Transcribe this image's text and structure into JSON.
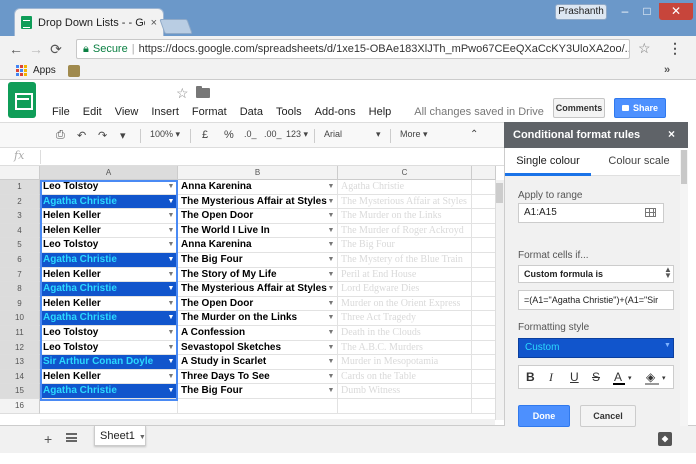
{
  "browser": {
    "tab_title": "Drop Down Lists - - Goo",
    "tab_close": "×",
    "user_name": "Prashanth",
    "win_min": "–",
    "win_max": "□",
    "win_close": "✕",
    "secure_label": "Secure",
    "url": "https://docs.google.com/spreadsheets/d/1xe15-OBAe183XlJTh_mPwo67CEeQXaCcKY3UloXA2oo/...",
    "bookmarks": {
      "apps_label": "Apps"
    },
    "more_label": "»"
  },
  "sheets": {
    "menu": [
      "File",
      "Edit",
      "View",
      "Insert",
      "Format",
      "Data",
      "Tools",
      "Add-ons",
      "Help"
    ],
    "save_status": "All changes saved in Drive",
    "comments_label": "Comments",
    "share_label": "Share",
    "toolbar": {
      "zoom": "100%",
      "currency": "£",
      "percent": "%",
      "dec_less": ".0_",
      "dec_more": ".00_",
      "format_more": "123",
      "font": "Arial",
      "more": "More"
    },
    "fx_label": "fx",
    "columns": [
      "A",
      "B",
      "C"
    ],
    "rows": [
      {
        "num": "1",
        "a": "Leo Tolstoy",
        "b": "Anna Karenina",
        "c": "Agatha Christie",
        "hl": false
      },
      {
        "num": "2",
        "a": "Agatha Christie",
        "b": "The Mysterious Affair at Styles",
        "c": "The Mysterious Affair at Styles",
        "hl": true
      },
      {
        "num": "3",
        "a": "Helen Keller",
        "b": "The Open Door",
        "c": "The Murder on the Links",
        "hl": false
      },
      {
        "num": "4",
        "a": "Helen Keller",
        "b": "The World I Live In",
        "c": "The Murder of Roger Ackroyd",
        "hl": false
      },
      {
        "num": "5",
        "a": "Leo Tolstoy",
        "b": "Anna Karenina",
        "c": "The Big Four",
        "hl": false
      },
      {
        "num": "6",
        "a": "Agatha Christie",
        "b": "The Big Four",
        "c": "The Mystery of the Blue Train",
        "hl": true
      },
      {
        "num": "7",
        "a": "Helen Keller",
        "b": "The Story of My Life",
        "c": "Peril at End House",
        "hl": false
      },
      {
        "num": "8",
        "a": "Agatha Christie",
        "b": "The Mysterious Affair at Styles",
        "c": "Lord Edgware Dies",
        "hl": true
      },
      {
        "num": "9",
        "a": "Helen Keller",
        "b": "The Open Door",
        "c": "Murder on the Orient Express",
        "hl": false
      },
      {
        "num": "10",
        "a": "Agatha Christie",
        "b": "The Murder on the Links",
        "c": "Three Act Tragedy",
        "hl": true
      },
      {
        "num": "11",
        "a": "Leo Tolstoy",
        "b": "A Confession",
        "c": "Death in the Clouds",
        "hl": false
      },
      {
        "num": "12",
        "a": "Leo Tolstoy",
        "b": "Sevastopol Sketches",
        "c": "The A.B.C. Murders",
        "hl": false
      },
      {
        "num": "13",
        "a": "Sir Arthur Conan Doyle",
        "b": "A Study in Scarlet",
        "c": "Murder in Mesopotamia",
        "hl": true
      },
      {
        "num": "14",
        "a": "Helen Keller",
        "b": "Three Days To See",
        "c": "Cards on the Table",
        "hl": false
      },
      {
        "num": "15",
        "a": "Agatha Christie",
        "b": "The Big Four",
        "c": "Dumb Witness",
        "hl": true
      },
      {
        "num": "16",
        "a": "",
        "b": "",
        "c": "",
        "hl": false
      }
    ],
    "sheet_tab": "Sheet1"
  },
  "panel": {
    "title": "Conditional format rules",
    "close": "×",
    "tab_single": "Single colour",
    "tab_scale": "Colour scale",
    "apply_label": "Apply to range",
    "range_value": "A1:A15",
    "format_cells_label": "Format cells if...",
    "condition": "Custom formula is",
    "formula": "=(A1=\"Agatha Christie\")+(A1=\"Sir",
    "style_label": "Formatting style",
    "style_value": "Custom",
    "fmt_bold": "B",
    "fmt_italic": "I",
    "fmt_underline": "U",
    "fmt_strike": "S",
    "fmt_textcolor": "A",
    "done_label": "Done",
    "cancel_label": "Cancel"
  },
  "colors": {
    "highlight_bg": "#1155cc",
    "highlight_text": "#2bd8ff",
    "sheets_green": "#0f9d58",
    "share_blue": "#4d90fe"
  }
}
